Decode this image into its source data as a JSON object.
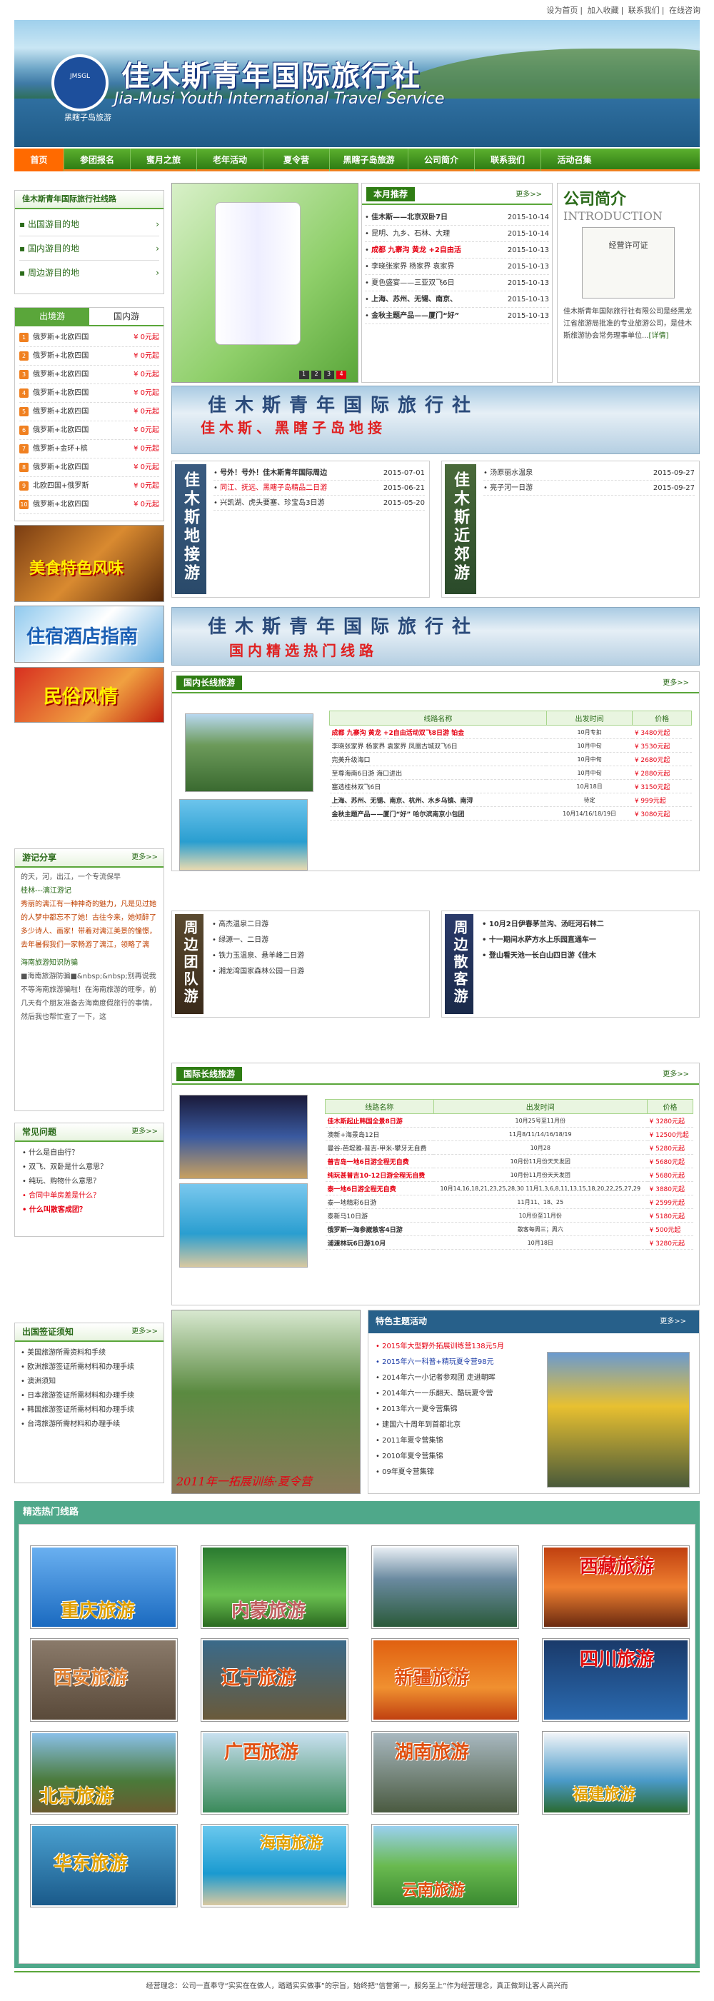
{
  "topbar": {
    "links": [
      "设为首页",
      "加入收藏",
      "联系我们",
      "在线咨询"
    ]
  },
  "banner": {
    "title": "佳木斯青年国际旅行社",
    "subtitle": "Jia-Musi Youth International Travel Service",
    "logo_text": "JMSGL",
    "tagline": "黑瞎子岛旅游"
  },
  "nav": {
    "items": [
      "首页",
      "参团报名",
      "蜜月之旅",
      "老年活动",
      "夏令营",
      "黑瞎子岛旅游",
      "公司简介",
      "联系我们",
      "活动召集"
    ]
  },
  "left": {
    "title": "佳木斯青年国际旅行社线路",
    "cats": [
      "出国游目的地",
      "国内游目的地",
      "周边游目的地"
    ],
    "tabs": [
      "出境游",
      "国内游"
    ],
    "tour_items": [
      {
        "n": "1",
        "t": "俄罗斯+北欧四国",
        "p": "¥ 0元起"
      },
      {
        "n": "2",
        "t": "俄罗斯+北欧四国",
        "p": "¥ 0元起"
      },
      {
        "n": "3",
        "t": "俄罗斯+北欧四国",
        "p": "¥ 0元起"
      },
      {
        "n": "4",
        "t": "俄罗斯+北欧四国",
        "p": "¥ 0元起"
      },
      {
        "n": "5",
        "t": "俄罗斯+北欧四国",
        "p": "¥ 0元起"
      },
      {
        "n": "6",
        "t": "俄罗斯+北欧四国",
        "p": "¥ 0元起"
      },
      {
        "n": "7",
        "t": "俄罗斯+金环+槟",
        "p": "¥ 0元起"
      },
      {
        "n": "8",
        "t": "俄罗斯+北欧四国",
        "p": "¥ 0元起"
      },
      {
        "n": "9",
        "t": "北欧四国+俄罗斯",
        "p": "¥ 0元起"
      },
      {
        "n": "10",
        "t": "俄罗斯+北欧四国",
        "p": "¥ 0元起"
      }
    ],
    "promos": [
      "美食特色风味",
      "住宿酒店指南",
      "民俗风情"
    ],
    "diary": {
      "title": "游记分享",
      "more": "更多>>",
      "lines": [
        "的天，河，出江，一个专流保早",
        "桂林---漓江游记",
        "秀丽的漓江有一种神奇的魅力，凡是见过她的人梦中都忘不了她！古往今来，她倾醉了多少诗人、画家！带着对漓江美景的憧憬，去年暑假我们一家畅游了漓江，领略了漓",
        "海南旅游知识防骗",
        "■海南旅游防骗■&nbsp;&nbsp;别再说我不等海南旅游骗啦！在海南旅游的旺季，前几天有个朋友准备去海南度假旅行的事情，然后我也帮忙查了一下，这"
      ]
    },
    "faq": {
      "title": "常见问题",
      "more": "更多>>",
      "items": [
        "什么是自由行？",
        "双飞、双卧是什么意思？",
        "纯玩、购物什么意思？",
        "合同中单房差是什么？",
        "什么叫散客成团？"
      ]
    },
    "visa": {
      "title": "出国签证须知",
      "more": "更多>>",
      "items": [
        "美国旅游所需资料和手续",
        "欧洲旅游签证所需材料和办理手续",
        "澳洲须知",
        "日本旅游签证所需材料和办理手续",
        "韩国旅游签证所需材料和办理手续",
        "台湾旅游所需材料和办理手续"
      ]
    }
  },
  "slider": {
    "pages": [
      "1",
      "2",
      "3",
      "4"
    ]
  },
  "month": {
    "title": "本月推荐",
    "more": "更多>>",
    "items": [
      {
        "t": "佳木斯——北京双卧7日",
        "d": "2015-10-14"
      },
      {
        "t": "昆明、九乡、石林、大理",
        "d": "2015-10-14"
      },
      {
        "t": "成都 九寨沟 黄龙 +2自由活",
        "d": "2015-10-13"
      },
      {
        "t": "李晓张家界 杨家界 袁家界",
        "d": "2015-10-13"
      },
      {
        "t": "夏色盛宴——三亚双飞6日",
        "d": "2015-10-13"
      },
      {
        "t": "上海、苏州、无锡、南京、",
        "d": "2015-10-13"
      },
      {
        "t": "金秋主题产品——厦门“好”",
        "d": "2015-10-13"
      }
    ]
  },
  "company": {
    "title": "公司简介",
    "en": "INTRODUCTION",
    "license": "经营许可证",
    "text": "佳木斯青年国际旅行社有限公司是经黑龙江省旅游局批准的专业旅游公司，是佳木斯旅游协会常务理事单位...",
    "detail": "[详情]"
  },
  "banner1": {
    "t1": "佳木斯青年国际旅行社",
    "t2": "佳木斯、黑瞎子岛地接"
  },
  "dijie": {
    "label": "佳木斯地接游",
    "items": [
      {
        "t": "号外！号外！佳木斯青年国际周边",
        "d": "2015-07-01"
      },
      {
        "t": "同江、抚远、黑瞎子岛精品二日游",
        "d": "2015-06-21"
      },
      {
        "t": "兴凯湖、虎头要塞、珍宝岛3日游",
        "d": "2015-05-20"
      }
    ]
  },
  "jinjiao": {
    "label": "佳木斯近郊游",
    "items": [
      {
        "t": "汤原丽水温泉",
        "d": "2015-09-27"
      },
      {
        "t": "亮子河一日游",
        "d": "2015-09-27"
      }
    ]
  },
  "banner2": {
    "t1": "佳木斯青年国际旅行社",
    "t2": "国内精选热门线路"
  },
  "domestic": {
    "title": "国内长线旅游",
    "more": "更多>>",
    "headers": [
      "线路名称",
      "出发时间",
      "价格"
    ],
    "rows": [
      {
        "n": "成都 九寨沟 黄龙 +2自由活动双飞8日游 铂金",
        "t": "10月专扣",
        "p": "¥ 3480元起",
        "s": "red"
      },
      {
        "n": "李晓张家界 杨家界 袁家界 凤凰古城双飞6日",
        "t": "10月中旬",
        "p": "¥ 3530元起",
        "s": ""
      },
      {
        "n": "完美升级海口",
        "t": "10月中旬",
        "p": "¥ 2680元起",
        "s": ""
      },
      {
        "n": "至尊海南6日游 海口进出",
        "t": "10月中旬",
        "p": "¥ 2880元起",
        "s": ""
      },
      {
        "n": "塞选桂林双飞6日",
        "t": "10月18日",
        "p": "¥ 3150元起",
        "s": ""
      },
      {
        "n": "上海、苏州、无锡、南京、杭州、水乡乌镇、南浔",
        "t": "待定",
        "p": "¥ 999元起",
        "s": "bold"
      },
      {
        "n": "金秋主题产品——厦门“好” 哈尔滨南京小包团",
        "t": "10月14/16/18/19日",
        "p": "¥ 3080元起",
        "s": "bold"
      }
    ]
  },
  "zhoubian": {
    "label": "周边团队游",
    "items": [
      "高杰温泉二日游",
      "绿源一、二日游",
      "铁力玉温泉、悬羊峰二日游",
      "湘龙湾国家森林公园一日游"
    ]
  },
  "sanke": {
    "label": "周边散客游",
    "items": [
      "10月2日伊春茅兰沟、汤旺河石林二",
      "十一期间水萨方水上乐园直通车一",
      "登山看天池一长白山四日游《佳木"
    ]
  },
  "intl": {
    "title": "国际长线旅游",
    "more": "更多>>",
    "headers": [
      "线路名称",
      "出发时间",
      "价格"
    ],
    "rows": [
      {
        "n": "佳木斯起止韩国全景8日游",
        "t": "10月25号至11月份",
        "p": "¥ 3280元起",
        "s": "red"
      },
      {
        "n": "澳新+海景岛12日",
        "t": "11月8/11/14/16/18/19",
        "p": "¥ 12500元起",
        "s": ""
      },
      {
        "n": "曼谷-芭堤雅-普吉-甲米-攀牙无自费",
        "t": "10月28",
        "p": "¥ 5280元起",
        "s": ""
      },
      {
        "n": "普吉岛一地6日游全程无自费",
        "t": "10月份11月份天天发团",
        "p": "¥ 5680元起",
        "s": "red"
      },
      {
        "n": "纯玩甚普吉10-12日游全程无自费",
        "t": "10月份11月份天天发团",
        "p": "¥ 5680元起",
        "s": "red"
      },
      {
        "n": "泰一地6日游全程无自费",
        "t": "10月14,16,18,21,23,25,28,30 11月1,3,6,8,11,13,15,18,20,22,25,27,29",
        "p": "¥ 3880元起",
        "s": "red"
      },
      {
        "n": "泰一地精彩6日游",
        "t": "11月11、18、25",
        "p": "¥ 2599元起",
        "s": ""
      },
      {
        "n": "泰新马10日游",
        "t": "10月份至11月份",
        "p": "¥ 5180元起",
        "s": ""
      },
      {
        "n": "俄罗斯一海参崴散客4日游",
        "t": "散客每周三；周六",
        "p": "¥ 500元起",
        "s": "bold"
      },
      {
        "n": "浦渡林玩6日游10月",
        "t": "10月18日",
        "p": "¥ 3280元起",
        "s": "bold"
      }
    ]
  },
  "theme": {
    "title": "特色主题活动",
    "more": "更多>>",
    "photo_caption": "2011年一拓展训练·夏令营",
    "items": [
      {
        "t": "2015年大型野外拓展训练营138元5月",
        "c": "red"
      },
      {
        "t": "2015年六一科普+精玩夏令营98元",
        "c": "blue"
      },
      {
        "t": "2014年六一小记者参观团 走进朝晖",
        "c": ""
      },
      {
        "t": "2014年六一一乐翻天、酷玩夏令营",
        "c": ""
      },
      {
        "t": "2013年六一夏令营集锦",
        "c": ""
      },
      {
        "t": "建国六十周年到首都北京",
        "c": ""
      },
      {
        "t": "2011年夏令营集锦",
        "c": ""
      },
      {
        "t": "2010年夏令营集锦",
        "c": ""
      },
      {
        "t": "09年夏令营集锦",
        "c": ""
      }
    ]
  },
  "hot": {
    "title": "精选热门线路",
    "tiles": [
      "重庆旅游",
      "内蒙旅游",
      "",
      "西藏旅游",
      "西安旅游",
      "辽宁旅游",
      "新疆旅游",
      "四川旅游",
      "北京旅游",
      "广西旅游",
      "湖南旅游",
      "福建旅游",
      "华东旅游",
      "海南旅游",
      "云南旅游"
    ]
  },
  "footer": {
    "text": "经营理念：公司一直奉守“实实在在做人，踏踏实实做事”的宗旨，始终把“信誉第一，服务至上”作为经营理念，真正做到让客人高兴而"
  },
  "colors": {
    "green": "#2f7d14",
    "orange": "#ff6a00",
    "red": "#e60012"
  }
}
